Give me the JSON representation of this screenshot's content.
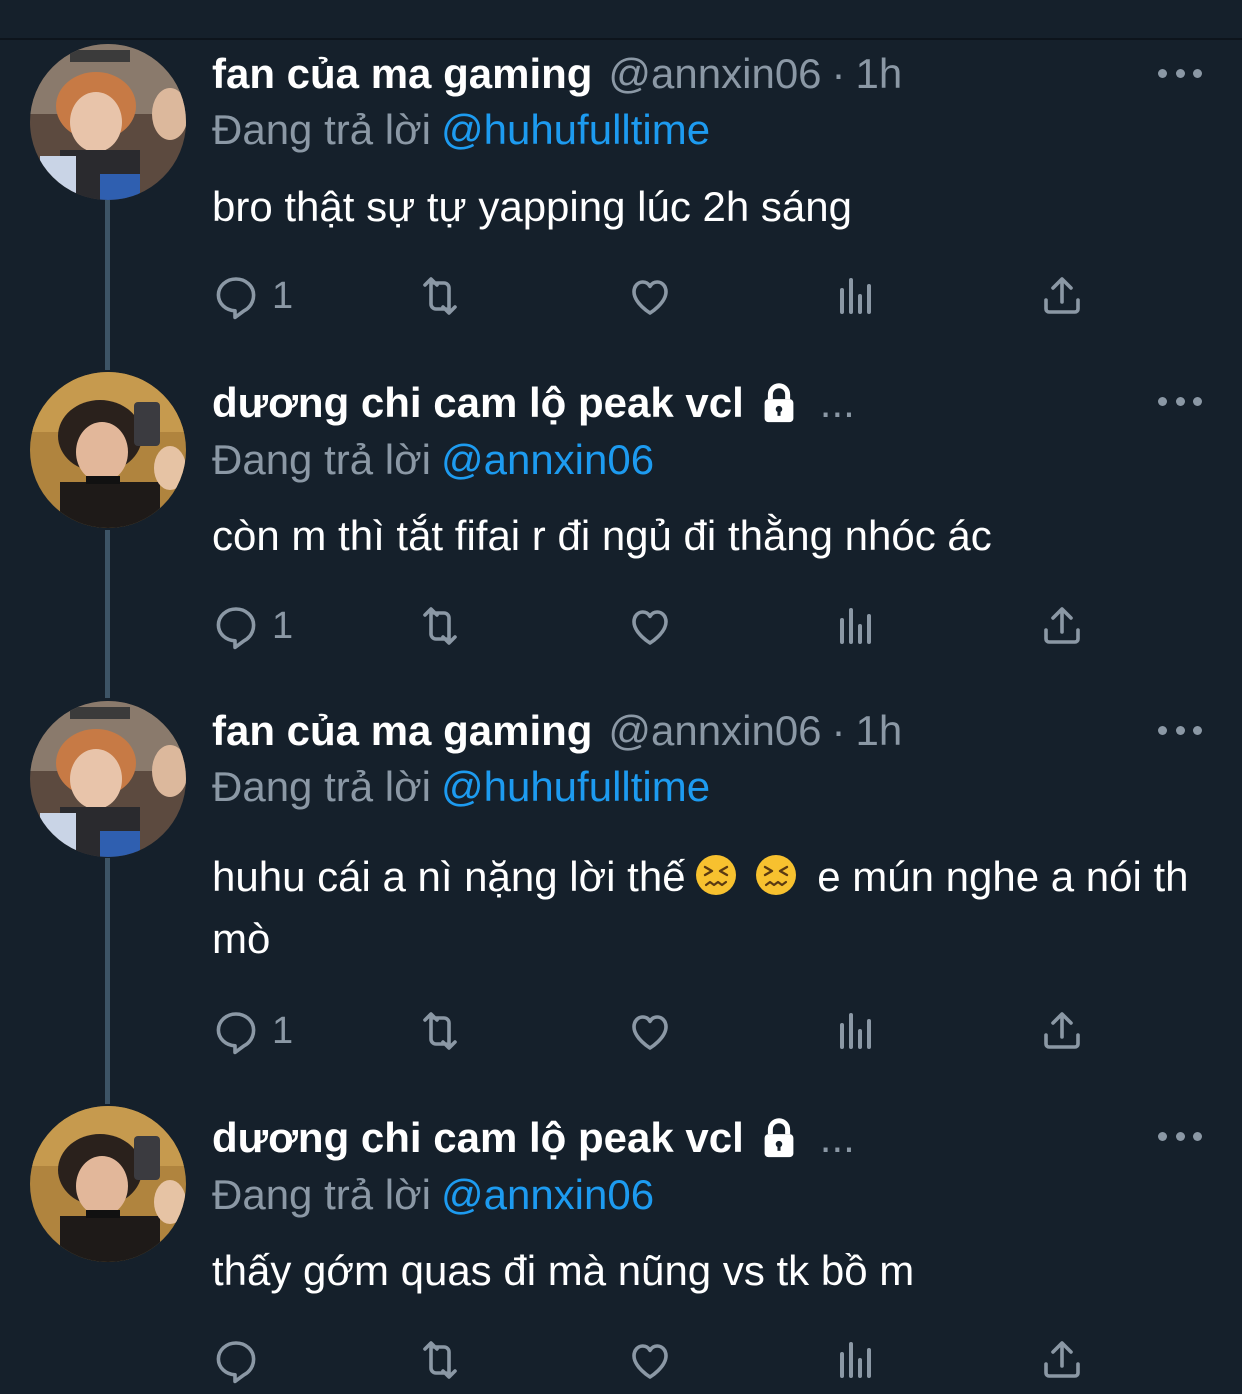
{
  "tweets": [
    {
      "display_name": "fan của ma gaming",
      "handle": "@annxin06",
      "dot": "·",
      "time": "1h",
      "replying_prefix": "Đang trả lời",
      "replying_to": "@huhufulltime",
      "text": "bro thật sự tự yapping lúc 2h sáng",
      "reply_count": "1"
    },
    {
      "display_name": "dương chi cam lộ peak vcl",
      "ellipsis": "...",
      "replying_prefix": "Đang trả lời",
      "replying_to": "@annxin06",
      "text": "còn m thì tắt fifai r đi ngủ đi thằng nhóc ác",
      "reply_count": "1"
    },
    {
      "display_name": "fan của ma gaming",
      "handle": "@annxin06",
      "dot": "·",
      "time": "1h",
      "replying_prefix": "Đang trả lời",
      "replying_to": "@huhufulltime",
      "text_part1": "huhu cái a nì nặng lời thế",
      "text_part2": " e mún nghe a nói th mò",
      "emoji": "confounded-face-emoji",
      "reply_count": "1"
    },
    {
      "display_name": "dương chi cam lộ peak vcl",
      "ellipsis": "...",
      "replying_prefix": "Đang trả lời",
      "replying_to": "@annxin06",
      "text": "thấy gớm quas đi mà nũng vs tk bồ m",
      "reply_count": ""
    }
  ],
  "colors": {
    "background": "#15202b",
    "secondary_text": "#8b98a5",
    "link": "#1d9bf0",
    "thread_line": "#3d5466"
  },
  "icons": [
    "reply-icon",
    "retweet-icon",
    "like-icon",
    "analytics-icon",
    "share-icon",
    "lock-icon",
    "more-icon"
  ]
}
